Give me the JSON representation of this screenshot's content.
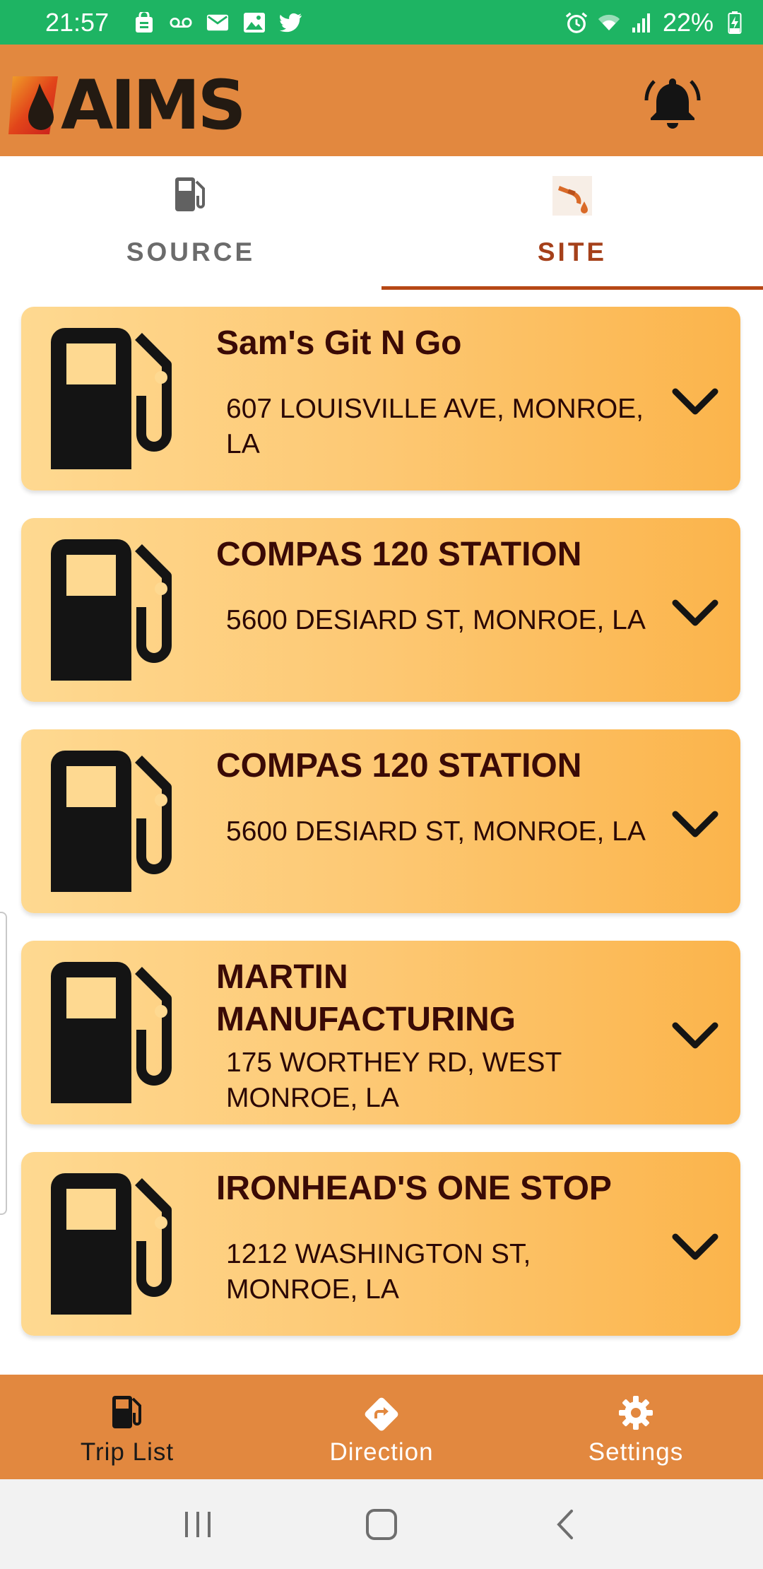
{
  "status_bar": {
    "time": "21:57",
    "battery": "22%",
    "left_icons": [
      "shopping-bag-icon",
      "voicemail-icon",
      "mail-icon",
      "image-icon",
      "twitter-icon"
    ],
    "right_icons": [
      "alarm-icon",
      "wifi-icon",
      "signal-icon",
      "battery-charging-icon"
    ]
  },
  "app_bar": {
    "logo_text": "AIMS",
    "notification_icon": "bell-icon"
  },
  "tabs": [
    {
      "label": "SOURCE",
      "icon": "fuel-pump-icon",
      "active": false
    },
    {
      "label": "SITE",
      "icon": "fuel-nozzle-icon",
      "active": true
    }
  ],
  "sites": [
    {
      "name": "Sam's Git N Go",
      "address": "607 LOUISVILLE AVE, MONROE, LA"
    },
    {
      "name": "COMPAS 120 STATION",
      "address": "5600 DESIARD ST, MONROE, LA"
    },
    {
      "name": "COMPAS 120 STATION",
      "address": "5600 DESIARD ST, MONROE, LA"
    },
    {
      "name": "MARTIN MANUFACTURING",
      "address": "175 WORTHEY RD, WEST MONROE, LA"
    },
    {
      "name": "IRONHEAD'S ONE STOP",
      "address": "1212 WASHINGTON ST, MONROE, LA"
    }
  ],
  "bottom_nav": [
    {
      "label": "Trip List",
      "icon": "fuel-pump-icon",
      "active": true
    },
    {
      "label": "Direction",
      "icon": "direction-icon",
      "active": false
    },
    {
      "label": "Settings",
      "icon": "gear-icon",
      "active": false
    }
  ],
  "colors": {
    "status_bar": "#1eb463",
    "app_bar": "#e2883f",
    "active_tab": "#a5401a",
    "card_start": "#fed991",
    "card_end": "#fbb44b",
    "card_title": "#3a0a06"
  }
}
